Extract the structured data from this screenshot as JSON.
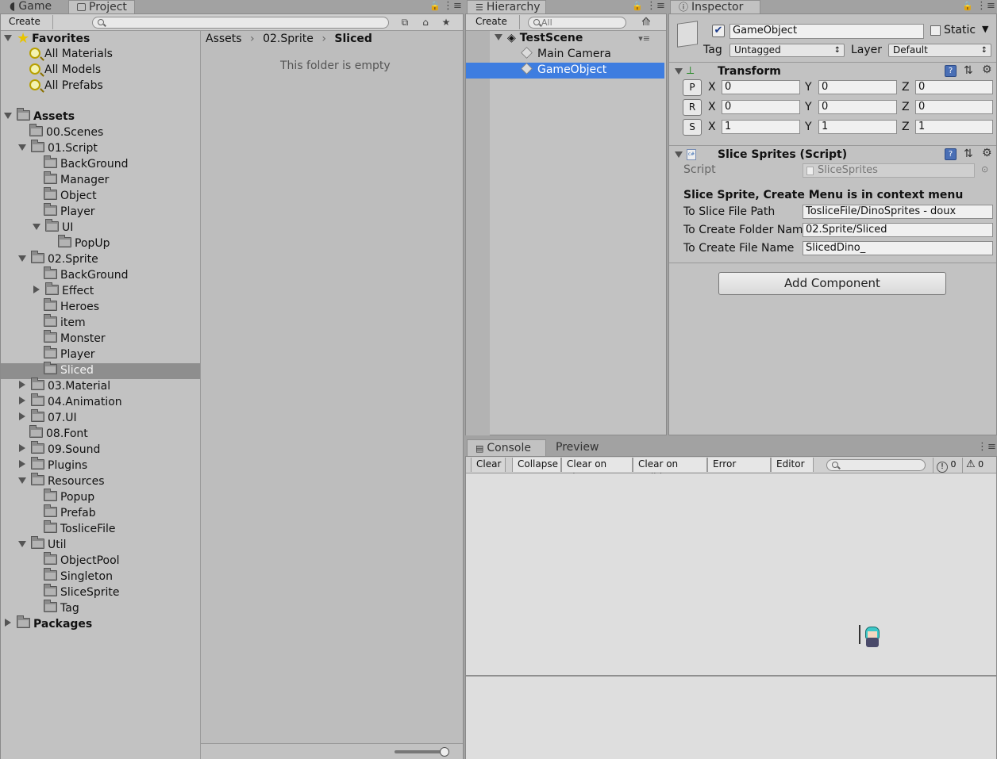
{
  "project_window": {
    "tabs": [
      {
        "label": "Game"
      },
      {
        "label": "Project"
      }
    ],
    "create_label": "Create",
    "breadcrumb": [
      "Assets",
      "02.Sprite",
      "Sliced"
    ],
    "empty_message": "This folder is empty",
    "favorites": {
      "label": "Favorites",
      "items": [
        "All Materials",
        "All Models",
        "All Prefabs"
      ]
    },
    "assets_label": "Assets",
    "tree": [
      {
        "label": "00.Scenes",
        "level": 1,
        "arrow": "none"
      },
      {
        "label": "01.Script",
        "level": 1,
        "arrow": "down"
      },
      {
        "label": "BackGround",
        "level": 2,
        "arrow": "none"
      },
      {
        "label": "Manager",
        "level": 2,
        "arrow": "none"
      },
      {
        "label": "Object",
        "level": 2,
        "arrow": "none"
      },
      {
        "label": "Player",
        "level": 2,
        "arrow": "none"
      },
      {
        "label": "UI",
        "level": 2,
        "arrow": "down"
      },
      {
        "label": "PopUp",
        "level": 3,
        "arrow": "none"
      },
      {
        "label": "02.Sprite",
        "level": 1,
        "arrow": "down"
      },
      {
        "label": "BackGround",
        "level": 2,
        "arrow": "none"
      },
      {
        "label": "Effect",
        "level": 2,
        "arrow": "right"
      },
      {
        "label": "Heroes",
        "level": 2,
        "arrow": "none"
      },
      {
        "label": "item",
        "level": 2,
        "arrow": "none"
      },
      {
        "label": "Monster",
        "level": 2,
        "arrow": "none"
      },
      {
        "label": "Player",
        "level": 2,
        "arrow": "none"
      },
      {
        "label": "Sliced",
        "level": 2,
        "arrow": "none",
        "selected": true
      },
      {
        "label": "03.Material",
        "level": 1,
        "arrow": "right"
      },
      {
        "label": "04.Animation",
        "level": 1,
        "arrow": "right"
      },
      {
        "label": "07.UI",
        "level": 1,
        "arrow": "right"
      },
      {
        "label": "08.Font",
        "level": 1,
        "arrow": "none"
      },
      {
        "label": "09.Sound",
        "level": 1,
        "arrow": "right"
      },
      {
        "label": "Plugins",
        "level": 1,
        "arrow": "right"
      },
      {
        "label": "Resources",
        "level": 1,
        "arrow": "down"
      },
      {
        "label": "Popup",
        "level": 2,
        "arrow": "none"
      },
      {
        "label": "Prefab",
        "level": 2,
        "arrow": "none"
      },
      {
        "label": "TosliceFile",
        "level": 2,
        "arrow": "none"
      },
      {
        "label": "Util",
        "level": 1,
        "arrow": "down"
      },
      {
        "label": "ObjectPool",
        "level": 2,
        "arrow": "none"
      },
      {
        "label": "Singleton",
        "level": 2,
        "arrow": "none"
      },
      {
        "label": "SliceSprite",
        "level": 2,
        "arrow": "none"
      },
      {
        "label": "Tag",
        "level": 2,
        "arrow": "none"
      }
    ],
    "packages_label": "Packages"
  },
  "hierarchy": {
    "tab_label": "Hierarchy",
    "create_label": "Create",
    "search_placeholder": "All",
    "scene_name": "TestScene",
    "items": [
      "Main Camera",
      "GameObject"
    ]
  },
  "inspector": {
    "tab_label": "Inspector",
    "object_name": "GameObject",
    "static_label": "Static",
    "tag_label": "Tag",
    "tag_value": "Untagged",
    "layer_label": "Layer",
    "layer_value": "Default",
    "transform": {
      "title": "Transform",
      "rows": [
        {
          "btn": "P",
          "x": "0",
          "y": "0",
          "z": "0"
        },
        {
          "btn": "R",
          "x": "0",
          "y": "0",
          "z": "0"
        },
        {
          "btn": "S",
          "x": "1",
          "y": "1",
          "z": "1"
        }
      ],
      "axis_x": "X",
      "axis_y": "Y",
      "axis_z": "Z"
    },
    "script_component": {
      "title": "Slice Sprites (Script)",
      "script_label": "Script",
      "script_value": "SliceSprites",
      "header": "Slice Sprite, Create Menu is in context menu",
      "fields": [
        {
          "label": "To Slice File Path",
          "value": "TosliceFile/DinoSprites - doux"
        },
        {
          "label": "To Create Folder Nam",
          "value": "02.Sprite/Sliced"
        },
        {
          "label": "To Create File Name",
          "value": "SlicedDino_"
        }
      ]
    },
    "add_component_label": "Add Component"
  },
  "console": {
    "tabs": [
      {
        "label": "Console"
      },
      {
        "label": "Preview"
      }
    ],
    "buttons": [
      "Clear",
      "Collapse",
      "Clear on Play",
      "Clear on Build",
      "Error Pause",
      "Editor"
    ],
    "info_count": "0",
    "warn_count": "0"
  },
  "colors": {
    "selection": "#3e7de0",
    "folder_selected": "#8e8e8e",
    "panel_bg": "#c2c2c2"
  }
}
